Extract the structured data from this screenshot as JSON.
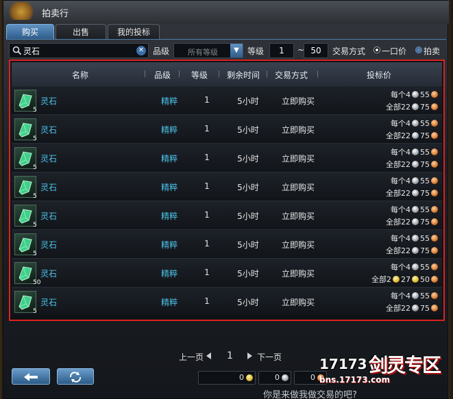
{
  "window": {
    "title": "拍卖行"
  },
  "tabs": [
    {
      "label": "购买",
      "active": true
    },
    {
      "label": "出售",
      "active": false
    },
    {
      "label": "我的投标",
      "active": false
    }
  ],
  "filters": {
    "search_value": "灵石",
    "grade_label": "品级",
    "grade_value": "所有等级",
    "level_label": "等级",
    "level_min": "1",
    "level_sep": "~",
    "level_max": "50",
    "trade_label": "交易方式",
    "trade_options": [
      "一口价",
      "拍卖"
    ]
  },
  "table": {
    "headers": [
      "名称",
      "品级",
      "等级",
      "剩余时间",
      "交易方式",
      "投标价"
    ],
    "rows": [
      {
        "qty": "5",
        "name": "灵石",
        "grade": "精粹",
        "level": "1",
        "time": "5小时",
        "trade": "立即购买",
        "unit_label": "每个4",
        "unit_silver": "55",
        "total_label": "全部22",
        "total_copper": "75"
      },
      {
        "qty": "5",
        "name": "灵石",
        "grade": "精粹",
        "level": "1",
        "time": "5小时",
        "trade": "立即购买",
        "unit_label": "每个4",
        "unit_silver": "55",
        "total_label": "全部22",
        "total_copper": "75"
      },
      {
        "qty": "5",
        "name": "灵石",
        "grade": "精粹",
        "level": "1",
        "time": "5小时",
        "trade": "立即购买",
        "unit_label": "每个4",
        "unit_silver": "55",
        "total_label": "全部22",
        "total_copper": "75"
      },
      {
        "qty": "5",
        "name": "灵石",
        "grade": "精粹",
        "level": "1",
        "time": "5小时",
        "trade": "立即购买",
        "unit_label": "每个4",
        "unit_silver": "55",
        "total_label": "全部22",
        "total_copper": "75"
      },
      {
        "qty": "5",
        "name": "灵石",
        "grade": "精粹",
        "level": "1",
        "time": "5小时",
        "trade": "立即购买",
        "unit_label": "每个4",
        "unit_silver": "55",
        "total_label": "全部22",
        "total_copper": "75"
      },
      {
        "qty": "5",
        "name": "灵石",
        "grade": "精粹",
        "level": "1",
        "time": "5小时",
        "trade": "立即购买",
        "unit_label": "每个4",
        "unit_silver": "55",
        "total_label": "全部22",
        "total_copper": "75"
      },
      {
        "qty": "50",
        "name": "灵石",
        "grade": "精粹",
        "level": "1",
        "time": "5小时",
        "trade": "立即购买",
        "unit_label": "每个4",
        "unit_silver": "55",
        "total_label": "全部2",
        "total_gold_mid": "27",
        "total_copper": "50"
      },
      {
        "qty": "5",
        "name": "灵石",
        "grade": "精粹",
        "level": "1",
        "time": "5小时",
        "trade": "立即购买",
        "unit_label": "每个4",
        "unit_silver": "55",
        "total_label": "全部22",
        "total_copper": "75"
      }
    ]
  },
  "pager": {
    "prev": "上一页",
    "page": "1",
    "next": "下一页"
  },
  "money": [
    "0",
    "0",
    "0"
  ],
  "footer": {
    "partial_text": "你是来做我做交易的吧?"
  },
  "watermark": {
    "number": "17173",
    "zh": "剑灵专区",
    "url": "bns.17173.com"
  }
}
